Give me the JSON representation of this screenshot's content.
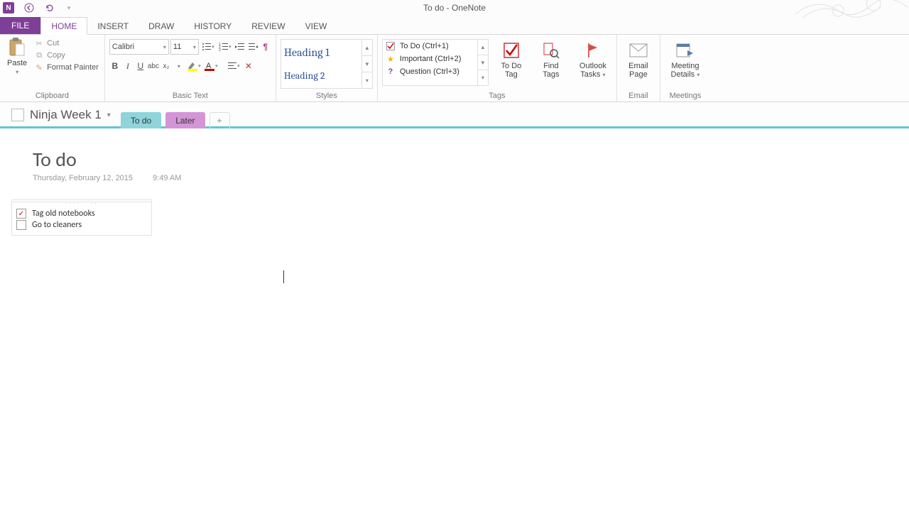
{
  "window": {
    "title": "To do - OneNote"
  },
  "ribbon_tabs": {
    "file": "FILE",
    "home": "HOME",
    "insert": "INSERT",
    "draw": "DRAW",
    "history": "HISTORY",
    "review": "REVIEW",
    "view": "VIEW"
  },
  "clipboard": {
    "paste": "Paste",
    "cut": "Cut",
    "copy": "Copy",
    "format_painter": "Format Painter",
    "group": "Clipboard"
  },
  "basic_text": {
    "font": "Calibri",
    "size": "11",
    "group": "Basic Text"
  },
  "styles": {
    "heading1": "Heading 1",
    "heading2": "Heading 2",
    "group": "Styles"
  },
  "tags": {
    "todo": "To Do (Ctrl+1)",
    "important": "Important (Ctrl+2)",
    "question": "Question (Ctrl+3)",
    "todo_tag_btn": "To Do Tag",
    "find_tags_btn": "Find Tags",
    "outlook_tasks_btn": "Outlook Tasks",
    "group": "Tags"
  },
  "email": {
    "email_page": "Email Page",
    "group": "Email"
  },
  "meetings": {
    "meeting_details": "Meeting Details",
    "group": "Meetings"
  },
  "notebook": {
    "name": "Ninja Week 1",
    "sections": {
      "todo": "To do",
      "later": "Later",
      "add": "+"
    }
  },
  "page": {
    "title": "To do",
    "date": "Thursday, February 12, 2015",
    "time": "9:49 AM",
    "items": [
      {
        "text": "Tag old notebooks",
        "checked": true
      },
      {
        "text": "Go to cleaners",
        "checked": false
      }
    ]
  }
}
